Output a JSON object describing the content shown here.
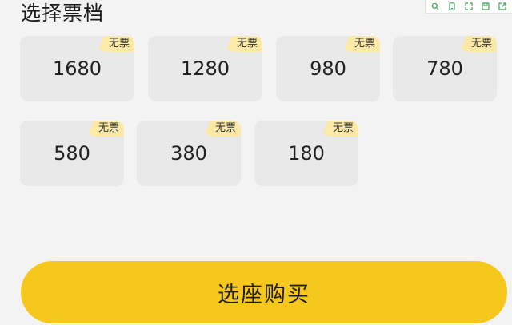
{
  "header": {
    "title": "选择票档"
  },
  "toolbar": {
    "icons": [
      "search-icon",
      "device-icon",
      "expand-icon",
      "save-icon",
      "export-icon"
    ],
    "accent": "#3aa55a"
  },
  "tickets": [
    {
      "price": "1680",
      "badge": "无票"
    },
    {
      "price": "1280",
      "badge": "无票"
    },
    {
      "price": "980",
      "badge": "无票"
    },
    {
      "price": "780",
      "badge": "无票"
    },
    {
      "price": "580",
      "badge": "无票"
    },
    {
      "price": "380",
      "badge": "无票"
    },
    {
      "price": "180",
      "badge": "无票"
    }
  ],
  "footer": {
    "buy_label": "选座购买"
  },
  "colors": {
    "background": "#f3f3f3",
    "ticket_bg": "#e9e9e9",
    "badge_bg": "#fde9a6",
    "button_bg": "#f6c81d"
  }
}
